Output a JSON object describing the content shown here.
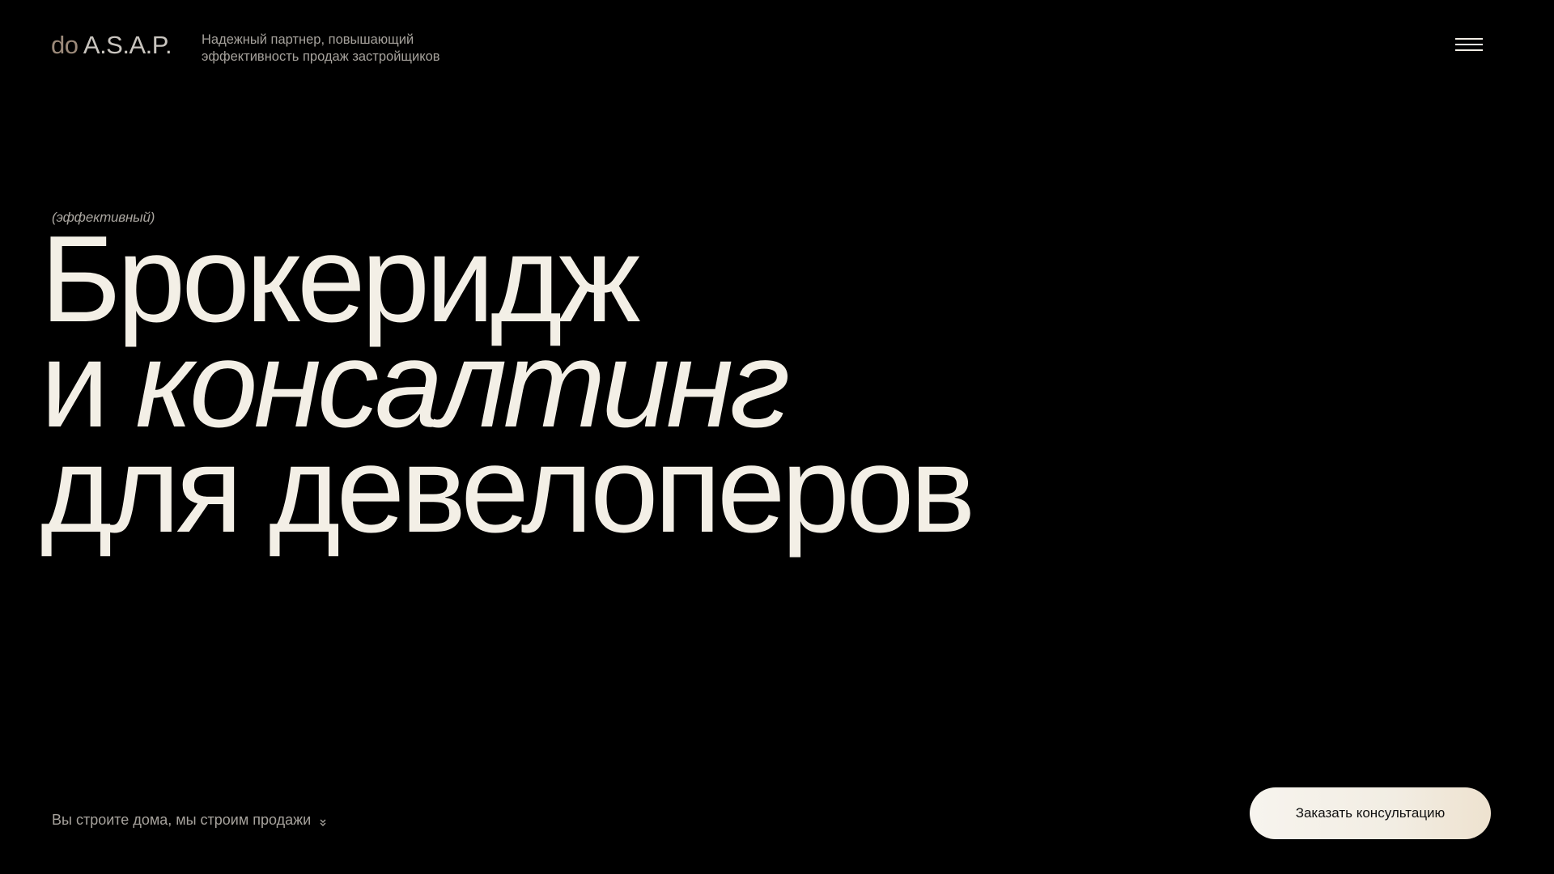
{
  "header": {
    "logo_prefix": "do",
    "logo_main": "A.S.A.P.",
    "tagline_line1": "Надежный партнер, повышающий",
    "tagline_line2": "эффективность продаж застройщиков",
    "menu_icon": "hamburger-icon"
  },
  "hero": {
    "eyebrow": "(эффективный)",
    "line1": "Брокеридж",
    "line2_regular": "и ",
    "line2_italic": "консалтинг",
    "line3": "для девелоперов"
  },
  "footer": {
    "note": "Вы строите дома, мы строим продажи",
    "note_icon": "double-chevron-down-icon",
    "cta_label": "Заказать консультацию"
  },
  "colors": {
    "background": "#000000",
    "headline": "#f3efe6",
    "muted_text": "#a6a29c",
    "logo_accent": "#9c8a7a",
    "cta_background": "#f5f1ea"
  }
}
